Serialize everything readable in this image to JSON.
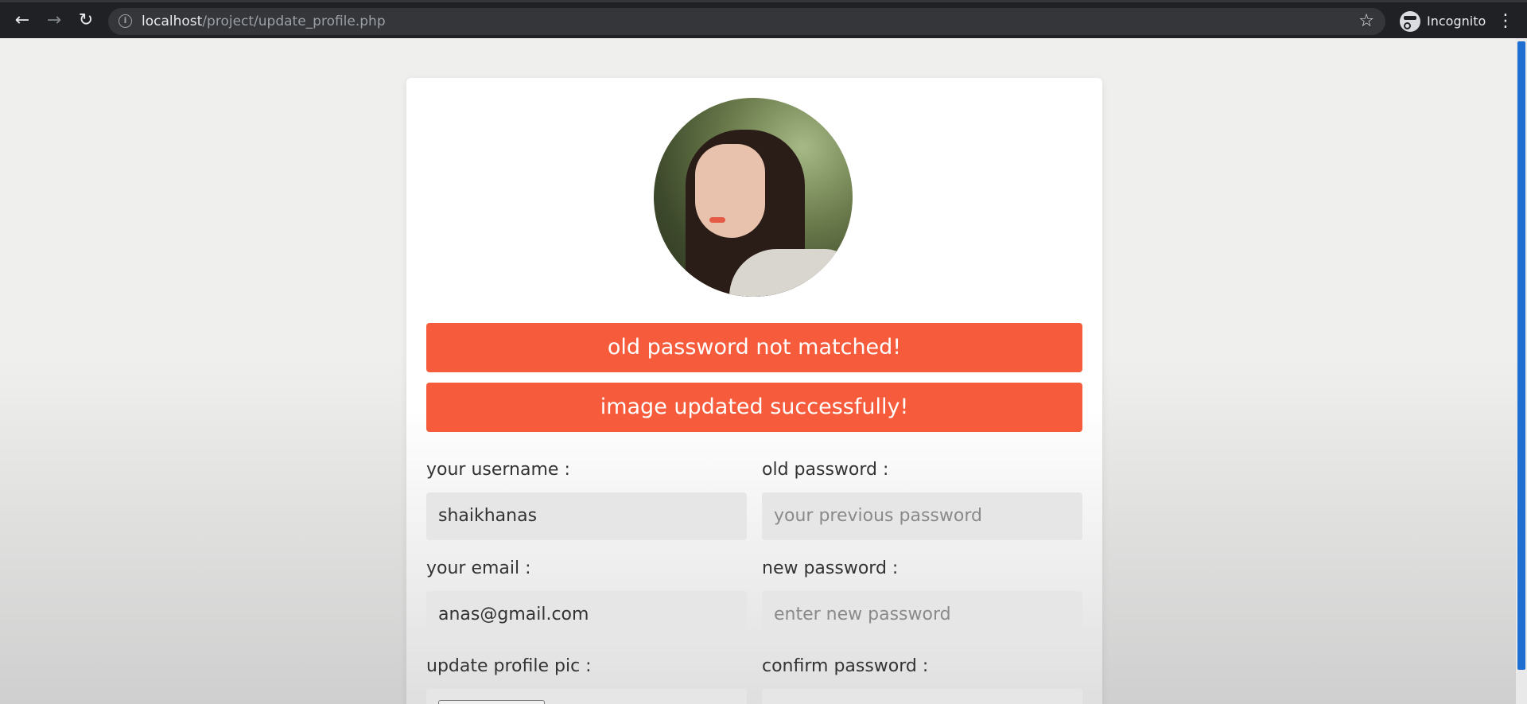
{
  "browser": {
    "url_host": "localhost",
    "url_path": "/project/update_profile.php",
    "profile_label": "Incognito"
  },
  "messages": [
    {
      "text": "old password not matched!"
    },
    {
      "text": "image updated successfully!"
    }
  ],
  "form": {
    "username": {
      "label": "your username :",
      "value": "shaikhanas"
    },
    "email": {
      "label": "your email :",
      "value": "anas@gmail.com"
    },
    "profile_pic": {
      "label": "update profile pic :"
    },
    "old_password": {
      "label": "old password :",
      "placeholder": "your previous password"
    },
    "new_password": {
      "label": "new password :",
      "placeholder": "enter new password"
    },
    "confirm_password": {
      "label": "confirm password :"
    }
  },
  "colors": {
    "accent": "#f65b3b",
    "field_bg": "#e6e6e6"
  }
}
